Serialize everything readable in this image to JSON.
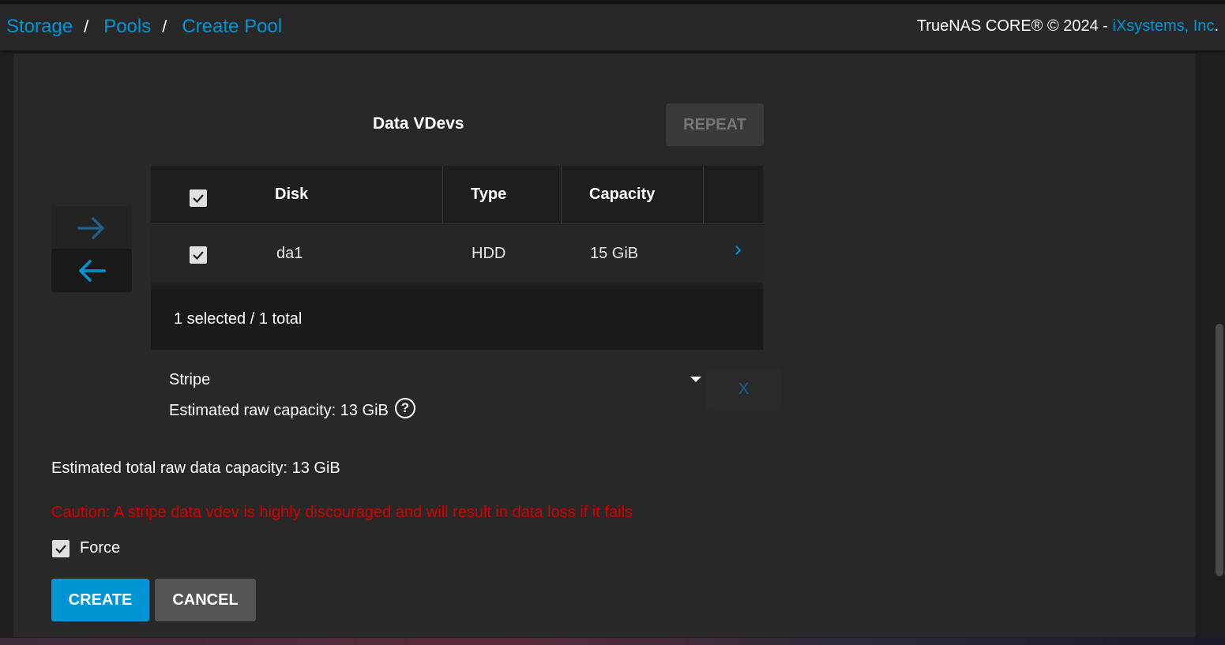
{
  "breadcrumb": {
    "items": [
      "Storage",
      "Pools",
      "Create Pool"
    ],
    "separator": "/"
  },
  "copyright": {
    "text": "TrueNAS CORE® © 2024 - ",
    "link": "iXsystems, Inc",
    "suffix": "."
  },
  "vdev": {
    "title": "Data VDevs",
    "repeat_label": "REPEAT",
    "table": {
      "columns": [
        "Disk",
        "Type",
        "Capacity"
      ],
      "rows": [
        {
          "disk": "da1",
          "type": "HDD",
          "capacity": "15 GiB",
          "checked": true
        }
      ],
      "footer": "1 selected / 1 total"
    },
    "layout_type": "Stripe",
    "remove_label": "X",
    "estimated_raw": "Estimated raw capacity: 13 GiB",
    "help_glyph": "?"
  },
  "total_capacity": "Estimated total raw data capacity: 13 GiB",
  "caution": "Caution: A stripe data vdev is highly discouraged and will result in data loss if it fails",
  "force": {
    "label": "Force",
    "checked": true
  },
  "actions": {
    "create_label": "CREATE",
    "cancel_label": "CANCEL"
  },
  "colors": {
    "accent": "#0095d5",
    "caution": "#d40000",
    "background": "#282828"
  },
  "icons": {
    "move_right": "arrow-right-icon",
    "move_left": "arrow-left-icon",
    "expand": "chevron-right-icon",
    "check": "checkmark-icon",
    "help": "help-circle-icon",
    "dropdown": "caret-down-icon"
  }
}
